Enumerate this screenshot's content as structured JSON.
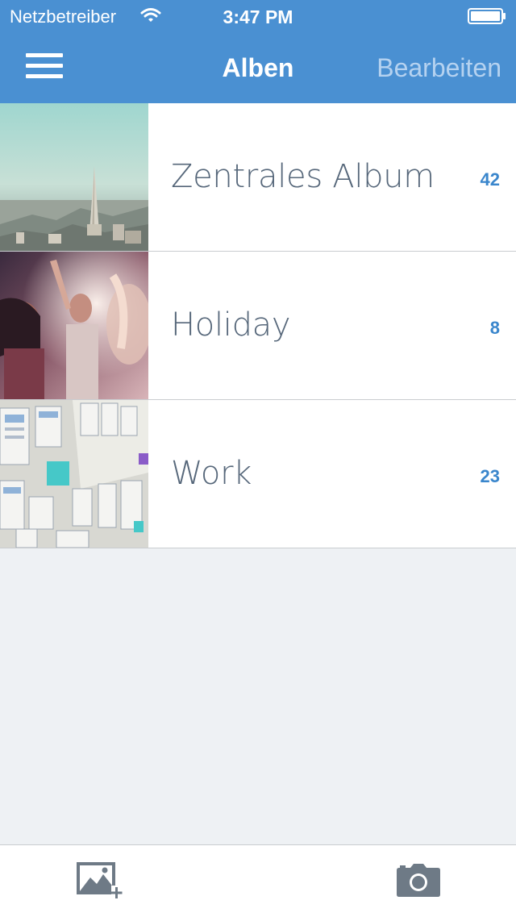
{
  "status_bar": {
    "carrier": "Netzbetreiber",
    "time": "3:47 PM"
  },
  "nav": {
    "title": "Alben",
    "edit_label": "Bearbeiten"
  },
  "albums": [
    {
      "title": "Zentrales Album",
      "count": "42",
      "thumb": "city-skyline"
    },
    {
      "title": "Holiday",
      "count": "8",
      "thumb": "party-people"
    },
    {
      "title": "Work",
      "count": "23",
      "thumb": "whiteboard-sketches"
    }
  ],
  "toolbar": {
    "add_photo_icon": "add-photo-icon",
    "camera_icon": "camera-icon"
  },
  "colors": {
    "header": "#4a90d2",
    "count_accent": "#3a86cc",
    "album_title": "#56677a",
    "background": "#eef1f4",
    "toolbar_icon": "#6e7a86"
  }
}
